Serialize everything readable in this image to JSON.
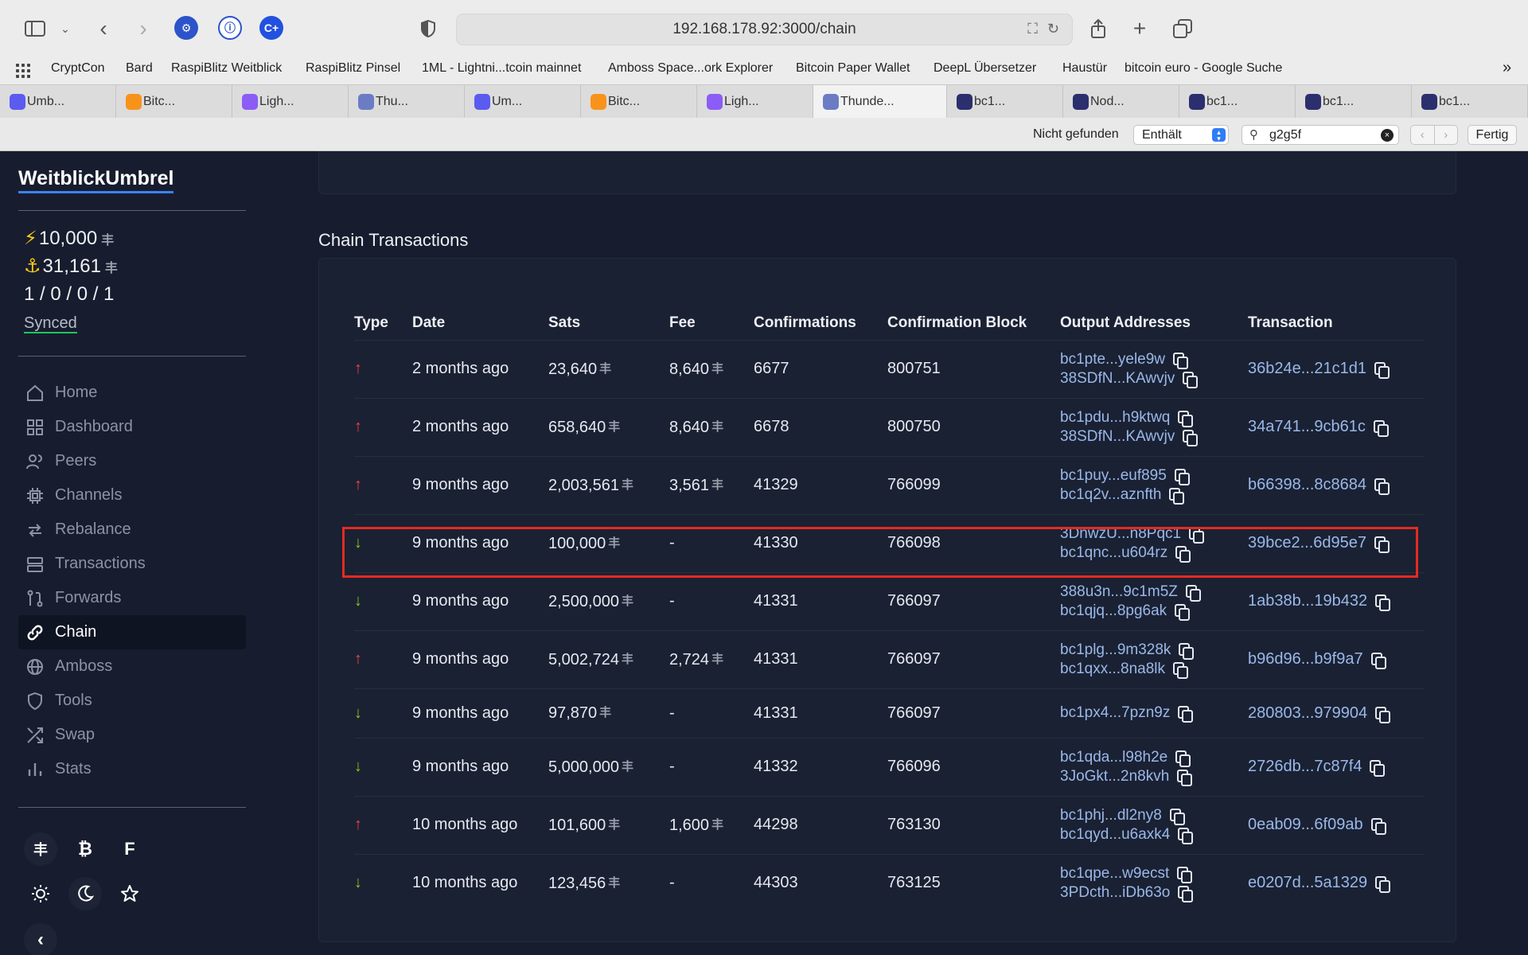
{
  "browser": {
    "url": "192.168.178.92:3000/chain",
    "bookmarks": [
      "CryptCon",
      "Bard",
      "RaspiBlitz Weitblick",
      "RaspiBlitz Pinsel",
      "1ML - Lightni...tcoin mainnet",
      "Amboss Space...ork Explorer",
      "Bitcoin Paper Wallet",
      "DeepL Übersetzer",
      "Haustür",
      "bitcoin euro - Google Suche"
    ],
    "tabs": [
      {
        "label": "Umb...",
        "color": "#5b5bf0"
      },
      {
        "label": "Bitc...",
        "color": "#f7931a"
      },
      {
        "label": "Ligh...",
        "color": "#8b5cf6"
      },
      {
        "label": "Thu...",
        "color": "#6b7cc4"
      },
      {
        "label": "Um...",
        "color": "#5b5bf0"
      },
      {
        "label": "Bitc...",
        "color": "#f7931a"
      },
      {
        "label": "Ligh...",
        "color": "#8b5cf6"
      },
      {
        "label": "Thunde...",
        "color": "#6b7cc4"
      },
      {
        "label": "bc1...",
        "color": "#2b2f6e"
      },
      {
        "label": "Nod...",
        "color": "#2b2f6e"
      },
      {
        "label": "bc1...",
        "color": "#2b2f6e"
      },
      {
        "label": "bc1...",
        "color": "#2b2f6e"
      },
      {
        "label": "bc1...",
        "color": "#2b2f6e"
      }
    ],
    "find": {
      "status": "Nicht gefunden",
      "mode": "Enthält",
      "query": "g2g5f",
      "done": "Fertig"
    }
  },
  "sidebar": {
    "node_name": "WeitblickUmbrel",
    "lightning_balance": "10,000",
    "onchain_balance": "31,161",
    "channel_counts": "1 / 0 / 0 / 1",
    "sync_status": "Synced",
    "nav": [
      {
        "label": "Home",
        "icon": "home-icon"
      },
      {
        "label": "Dashboard",
        "icon": "dashboard-icon"
      },
      {
        "label": "Peers",
        "icon": "peers-icon"
      },
      {
        "label": "Channels",
        "icon": "channels-icon"
      },
      {
        "label": "Rebalance",
        "icon": "rebalance-icon"
      },
      {
        "label": "Transactions",
        "icon": "transactions-icon"
      },
      {
        "label": "Forwards",
        "icon": "forwards-icon"
      },
      {
        "label": "Chain",
        "icon": "chain-icon",
        "active": true
      },
      {
        "label": "Amboss",
        "icon": "globe-icon"
      },
      {
        "label": "Tools",
        "icon": "shield-icon"
      },
      {
        "label": "Swap",
        "icon": "swap-icon"
      },
      {
        "label": "Stats",
        "icon": "stats-icon"
      }
    ],
    "currency_buttons": {
      "sats": "丰",
      "btc": "₿",
      "fiat": "F"
    }
  },
  "main": {
    "section_title": "Chain Transactions",
    "columns": [
      "Type",
      "Date",
      "Sats",
      "Fee",
      "Confirmations",
      "Confirmation Block",
      "Output Addresses",
      "Transaction"
    ],
    "rows": [
      {
        "dir": "up",
        "date": "2 months ago",
        "sats": "23,640",
        "fee": "8,640",
        "conf": "6677",
        "block": "800751",
        "addrs": [
          "bc1pte...yele9w",
          "38SDfN...KAwvjv"
        ],
        "tx": "36b24e...21c1d1"
      },
      {
        "dir": "up",
        "date": "2 months ago",
        "sats": "658,640",
        "fee": "8,640",
        "conf": "6678",
        "block": "800750",
        "addrs": [
          "bc1pdu...h9ktwq",
          "38SDfN...KAwvjv"
        ],
        "tx": "34a741...9cb61c"
      },
      {
        "dir": "up",
        "date": "9 months ago",
        "sats": "2,003,561",
        "fee": "3,561",
        "conf": "41329",
        "block": "766099",
        "addrs": [
          "bc1puy...euf895",
          "bc1q2v...aznfth"
        ],
        "tx": "b66398...8c8684"
      },
      {
        "dir": "down",
        "date": "9 months ago",
        "sats": "100,000",
        "fee": "-",
        "conf": "41330",
        "block": "766098",
        "addrs": [
          "3DnwzU...n8Pqc1",
          "bc1qnc...u604rz"
        ],
        "tx": "39bce2...6d95e7"
      },
      {
        "dir": "down",
        "date": "9 months ago",
        "sats": "2,500,000",
        "fee": "-",
        "conf": "41331",
        "block": "766097",
        "addrs": [
          "388u3n...9c1m5Z",
          "bc1qjq...8pg6ak"
        ],
        "tx": "1ab38b...19b432"
      },
      {
        "dir": "up",
        "date": "9 months ago",
        "sats": "5,002,724",
        "fee": "2,724",
        "conf": "41331",
        "block": "766097",
        "addrs": [
          "bc1plg...9m328k",
          "bc1qxx...8na8lk"
        ],
        "tx": "b96d96...b9f9a7"
      },
      {
        "dir": "down",
        "date": "9 months ago",
        "sats": "97,870",
        "fee": "-",
        "conf": "41331",
        "block": "766097",
        "addrs": [
          "bc1px4...7pzn9z"
        ],
        "tx": "280803...979904"
      },
      {
        "dir": "down",
        "date": "9 months ago",
        "sats": "5,000,000",
        "fee": "-",
        "conf": "41332",
        "block": "766096",
        "addrs": [
          "bc1qda...l98h2e",
          "3JoGkt...2n8kvh"
        ],
        "tx": "2726db...7c87f4"
      },
      {
        "dir": "up",
        "date": "10 months ago",
        "sats": "101,600",
        "fee": "1,600",
        "conf": "44298",
        "block": "763130",
        "addrs": [
          "bc1phj...dl2ny8",
          "bc1qyd...u6axk4"
        ],
        "tx": "0eab09...6f09ab"
      },
      {
        "dir": "down",
        "date": "10 months ago",
        "sats": "123,456",
        "fee": "-",
        "conf": "44303",
        "block": "763125",
        "addrs": [
          "bc1qpe...w9ecst",
          "3PDcth...iDb63o"
        ],
        "tx": "e0207d...5a1329"
      }
    ]
  },
  "colors": {
    "accent": "#3b82f6",
    "send": "#ef4444",
    "receive": "#84cc16",
    "highlight": "#e52b20",
    "link": "#9ab8e8"
  }
}
